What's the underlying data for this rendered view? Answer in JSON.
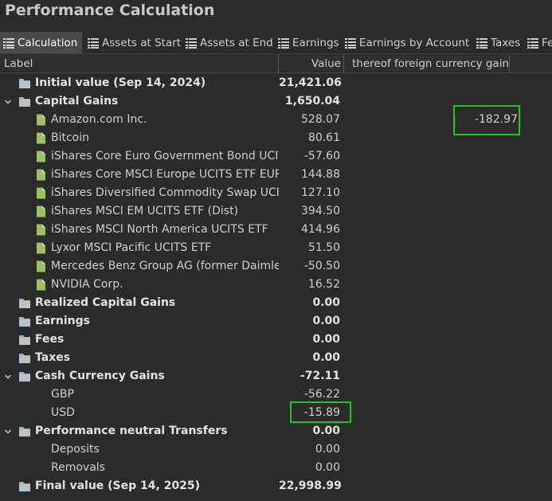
{
  "window": {
    "title": "Performance Calculation"
  },
  "tabs": [
    {
      "label": "Calculation",
      "active": true
    },
    {
      "label": "Assets at Start",
      "active": false
    },
    {
      "label": "Assets at End",
      "active": false
    },
    {
      "label": "Earnings",
      "active": false
    },
    {
      "label": "Earnings by Account",
      "active": false
    },
    {
      "label": "Taxes",
      "active": false
    },
    {
      "label": "Fe",
      "active": false
    }
  ],
  "columns": {
    "label": "Label",
    "value": "Value",
    "fx": "thereof foreign currency gains"
  },
  "rows": [
    {
      "label": "Initial value (Sep 14, 2024)",
      "value": "21,421.06",
      "fx": ""
    },
    {
      "label": "Capital Gains",
      "value": "1,650.04",
      "fx": ""
    },
    {
      "label": "Amazon.com Inc.",
      "value": "528.07",
      "fx": "-182.97"
    },
    {
      "label": "Bitcoin",
      "value": "80.61",
      "fx": ""
    },
    {
      "label": "iShares Core Euro Government Bond UCITS",
      "value": "-57.60",
      "fx": ""
    },
    {
      "label": "iShares Core MSCI Europe UCITS ETF EUR (D",
      "value": "144.88",
      "fx": ""
    },
    {
      "label": "iShares Diversified Commodity Swap UCITS",
      "value": "127.10",
      "fx": ""
    },
    {
      "label": "iShares MSCI EM UCITS ETF (Dist)",
      "value": "394.50",
      "fx": ""
    },
    {
      "label": "iShares MSCI North America UCITS ETF",
      "value": "414.96",
      "fx": ""
    },
    {
      "label": "Lyxor MSCI Pacific UCITS ETF",
      "value": "51.50",
      "fx": ""
    },
    {
      "label": "Mercedes Benz Group AG (former Daimler)",
      "value": "-50.50",
      "fx": ""
    },
    {
      "label": "NVIDIA Corp.",
      "value": "16.52",
      "fx": ""
    },
    {
      "label": "Realized Capital Gains",
      "value": "0.00",
      "fx": ""
    },
    {
      "label": "Earnings",
      "value": "0.00",
      "fx": ""
    },
    {
      "label": "Fees",
      "value": "0.00",
      "fx": ""
    },
    {
      "label": "Taxes",
      "value": "0.00",
      "fx": ""
    },
    {
      "label": "Cash Currency Gains",
      "value": "-72.11",
      "fx": ""
    },
    {
      "label": "GBP",
      "value": "-56.22",
      "fx": ""
    },
    {
      "label": "USD",
      "value": "-15.89",
      "fx": ""
    },
    {
      "label": "Performance neutral Transfers",
      "value": "0.00",
      "fx": ""
    },
    {
      "label": "Deposits",
      "value": "0.00",
      "fx": ""
    },
    {
      "label": "Removals",
      "value": "0.00",
      "fx": ""
    },
    {
      "label": "Final value (Sep 14, 2025)",
      "value": "22,998.99",
      "fx": ""
    }
  ],
  "icons": {
    "list": "list-icon",
    "folder": "folder-icon",
    "document": "document-icon",
    "chevron": "chevron-down-icon"
  },
  "colors": {
    "highlight": "#1ec81e",
    "folder": "#a8b3bd",
    "document": "#9cc06a",
    "active_tab": "#4a4a4a"
  }
}
